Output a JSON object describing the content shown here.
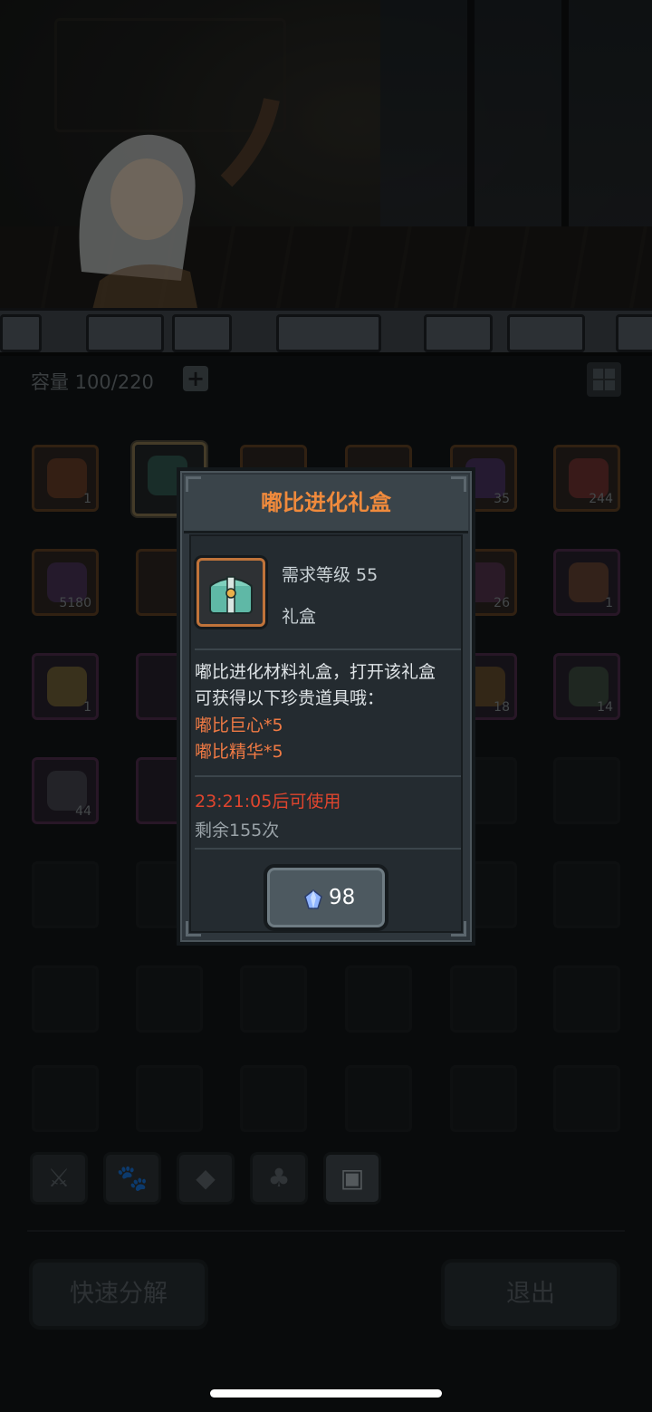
{
  "inventory": {
    "capacity": "容量 100/220",
    "plus": "+",
    "slots": [
      {
        "count": "1"
      },
      {
        "count": ""
      },
      {
        "count": ""
      },
      {
        "count": ""
      },
      {
        "count": "35"
      },
      {
        "count": "244"
      },
      {
        "count": "5180"
      },
      {
        "count": ""
      },
      {
        "count": ""
      },
      {
        "count": ""
      },
      {
        "count": "26"
      },
      {
        "count": "1"
      },
      {
        "count": "1"
      },
      {
        "count": ""
      },
      {
        "count": ""
      },
      {
        "count": ""
      },
      {
        "count": "18"
      },
      {
        "count": "14"
      },
      {
        "count": "44"
      },
      {
        "count": ""
      }
    ]
  },
  "categories": [
    "⚔",
    "🐾",
    "◆",
    "♣",
    "▣"
  ],
  "buttons": {
    "decompose": "快速分解",
    "exit": "退出"
  },
  "dialog": {
    "title": "嘟比进化礼盒",
    "required_level": "需求等级 55",
    "item_type": "礼盒",
    "description_line1": "嘟比进化材料礼盒，打开该礼盒",
    "description_line2": "可获得以下珍贵道具哦：",
    "reward1": "嘟比巨心*5",
    "reward2": "嘟比精华*5",
    "timer": "23:21:05后可使用",
    "remaining": "剩余155次",
    "cost": "98"
  },
  "colors": {
    "title_orange": "#f08a3c",
    "reward_orange": "#f07a44",
    "timer_red": "#e0452e"
  }
}
